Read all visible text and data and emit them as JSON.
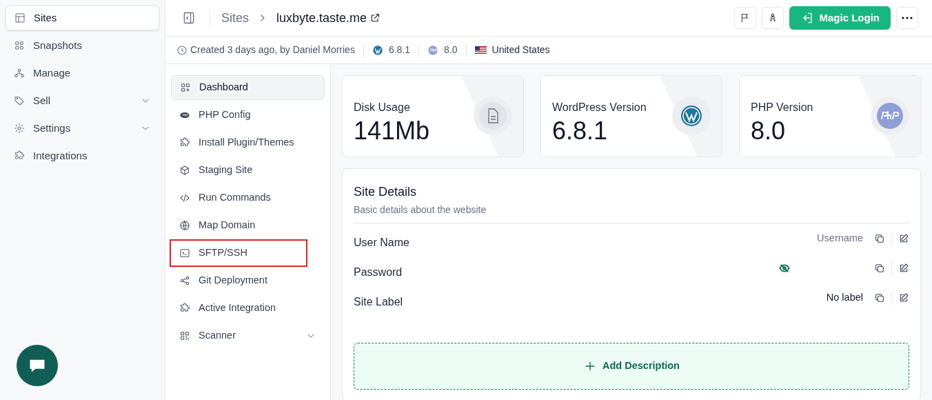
{
  "sidebar": {
    "items": [
      {
        "label": "Sites",
        "selected": true,
        "expandable": false
      },
      {
        "label": "Snapshots",
        "selected": false,
        "expandable": false
      },
      {
        "label": "Manage",
        "selected": false,
        "expandable": false
      },
      {
        "label": "Sell",
        "selected": false,
        "expandable": true
      },
      {
        "label": "Settings",
        "selected": false,
        "expandable": true
      },
      {
        "label": "Integrations",
        "selected": false,
        "expandable": false
      }
    ]
  },
  "header": {
    "breadcrumb": [
      "Sites",
      "luxbyte.taste.me"
    ],
    "buttons": [
      {
        "kind": "flag"
      },
      {
        "kind": "rocket"
      },
      {
        "kind": "primary",
        "label": "Magic Login"
      },
      {
        "kind": "more"
      }
    ]
  },
  "info_bar": {
    "created": "Created 3 days ago, by Daniel Morries",
    "wordpress": "6.8.1",
    "php": "8.0",
    "country": "United States"
  },
  "site_nav": {
    "items": [
      {
        "label": "Dashboard",
        "selected": true,
        "highlighted": false,
        "expandable": false
      },
      {
        "label": "PHP Config",
        "selected": false,
        "highlighted": false,
        "expandable": false
      },
      {
        "label": "Install Plugin/Themes",
        "selected": false,
        "highlighted": false,
        "expandable": false
      },
      {
        "label": "Staging Site",
        "selected": false,
        "highlighted": false,
        "expandable": false
      },
      {
        "label": "Run Commands",
        "selected": false,
        "highlighted": false,
        "expandable": false
      },
      {
        "label": "Map Domain",
        "selected": false,
        "highlighted": false,
        "expandable": false
      },
      {
        "label": "SFTP/SSH",
        "selected": false,
        "highlighted": true,
        "expandable": false
      },
      {
        "label": "Git Deployment",
        "selected": false,
        "highlighted": false,
        "expandable": false
      },
      {
        "label": "Active Integration",
        "selected": false,
        "highlighted": false,
        "expandable": false
      },
      {
        "label": "Scanner",
        "selected": false,
        "highlighted": false,
        "expandable": true
      }
    ]
  },
  "stats": [
    {
      "kind": "disk",
      "label": "Disk Usage",
      "value": "141Mb"
    },
    {
      "kind": "wordpress",
      "label": "WordPress Version",
      "value": "6.8.1"
    },
    {
      "kind": "php",
      "label": "PHP Version",
      "value": "8.0"
    }
  ],
  "site_details": {
    "title": "Site Details",
    "subtitle": "Basic details about the website",
    "fields": [
      {
        "kind": "text",
        "label": "User Name",
        "placeholder": "Username"
      },
      {
        "kind": "secret",
        "label": "Password"
      },
      {
        "kind": "text",
        "label": "Site Label",
        "value": "No label"
      }
    ],
    "add_button": "Add Description"
  }
}
